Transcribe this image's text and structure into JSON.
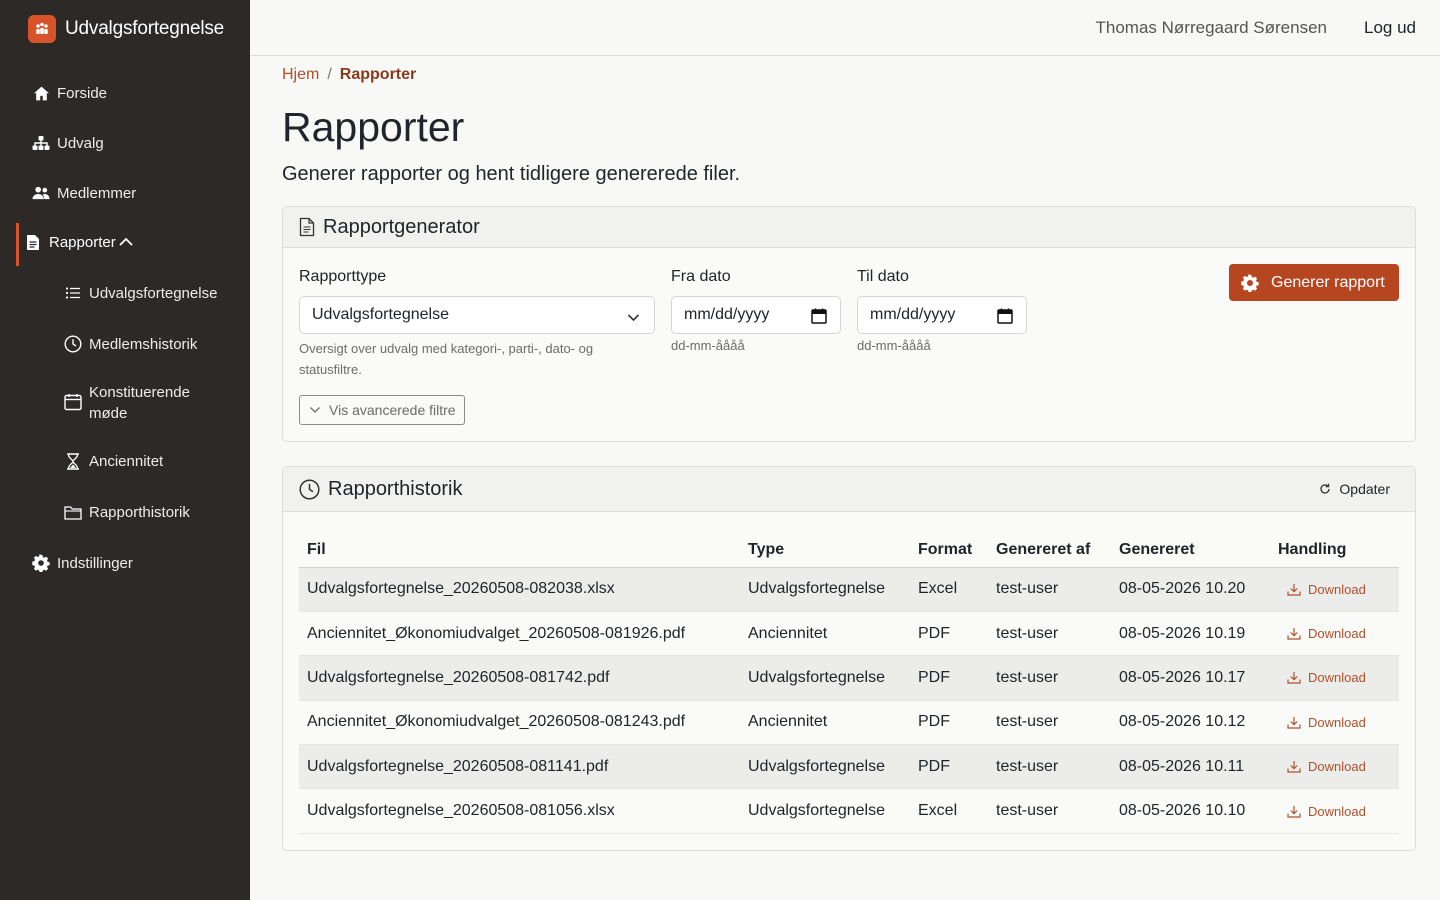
{
  "app": {
    "name": "Udvalgsfortegnelse"
  },
  "sidebar": {
    "items": [
      {
        "label": "Forside",
        "icon": "home-icon"
      },
      {
        "label": "Udvalg",
        "icon": "sitemap-icon"
      },
      {
        "label": "Medlemmer",
        "icon": "users-icon"
      },
      {
        "label": "Rapporter",
        "icon": "document-icon"
      },
      {
        "label": "Indstillinger",
        "icon": "gear-icon"
      }
    ],
    "sub_items": [
      {
        "label": "Udvalgsfortegnelse",
        "icon": "list-icon"
      },
      {
        "label": "Medlemshistorik",
        "icon": "clock-icon"
      },
      {
        "label": "Konstituerende møde",
        "icon": "calendar-icon"
      },
      {
        "label": "Anciennitet",
        "icon": "hourglass-icon"
      },
      {
        "label": "Rapporthistorik",
        "icon": "folder-icon"
      }
    ]
  },
  "topbar": {
    "user": "Thomas Nørregaard Sørensen",
    "logout": "Log ud"
  },
  "breadcrumb": {
    "home": "Hjem",
    "separator": "/",
    "current": "Rapporter"
  },
  "page": {
    "title": "Rapporter",
    "subtitle": "Generer rapporter og hent tidligere genererede filer."
  },
  "generator": {
    "title": "Rapportgenerator",
    "type_label": "Rapporttype",
    "type_value": "Udvalgsfortegnelse",
    "type_help": "Oversigt over udvalg med kategori-, parti-, dato- og statusfiltre.",
    "from_label": "Fra dato",
    "to_label": "Til dato",
    "date_placeholder": "mm/dd/yyyy",
    "date_help": "dd-mm-åååå",
    "advanced_button": "Vis avancerede filtre",
    "generate_button": "Generer rapport"
  },
  "history": {
    "title": "Rapporthistorik",
    "refresh": "Opdater",
    "columns": [
      "Fil",
      "Type",
      "Format",
      "Genereret af",
      "Genereret",
      "Handling"
    ],
    "rows": [
      {
        "file": "Udvalgsfortegnelse_20260508-082038.xlsx",
        "type": "Udvalgsfortegnelse",
        "format": "Excel",
        "by": "test-user",
        "when": "08-05-2026 10.20",
        "action": "Download"
      },
      {
        "file": "Anciennitet_Økonomiudvalget_20260508-081926.pdf",
        "type": "Anciennitet",
        "format": "PDF",
        "by": "test-user",
        "when": "08-05-2026 10.19",
        "action": "Download"
      },
      {
        "file": "Udvalgsfortegnelse_20260508-081742.pdf",
        "type": "Udvalgsfortegnelse",
        "format": "PDF",
        "by": "test-user",
        "when": "08-05-2026 10.17",
        "action": "Download"
      },
      {
        "file": "Anciennitet_Økonomiudvalget_20260508-081243.pdf",
        "type": "Anciennitet",
        "format": "PDF",
        "by": "test-user",
        "when": "08-05-2026 10.12",
        "action": "Download"
      },
      {
        "file": "Udvalgsfortegnelse_20260508-081141.pdf",
        "type": "Udvalgsfortegnelse",
        "format": "PDF",
        "by": "test-user",
        "when": "08-05-2026 10.11",
        "action": "Download"
      },
      {
        "file": "Udvalgsfortegnelse_20260508-081056.xlsx",
        "type": "Udvalgsfortegnelse",
        "format": "Excel",
        "by": "test-user",
        "when": "08-05-2026 10.10",
        "action": "Download"
      }
    ]
  },
  "colors": {
    "accent": "#b6461f",
    "sidebar_bg": "#2d2927",
    "link": "#b0502a"
  }
}
